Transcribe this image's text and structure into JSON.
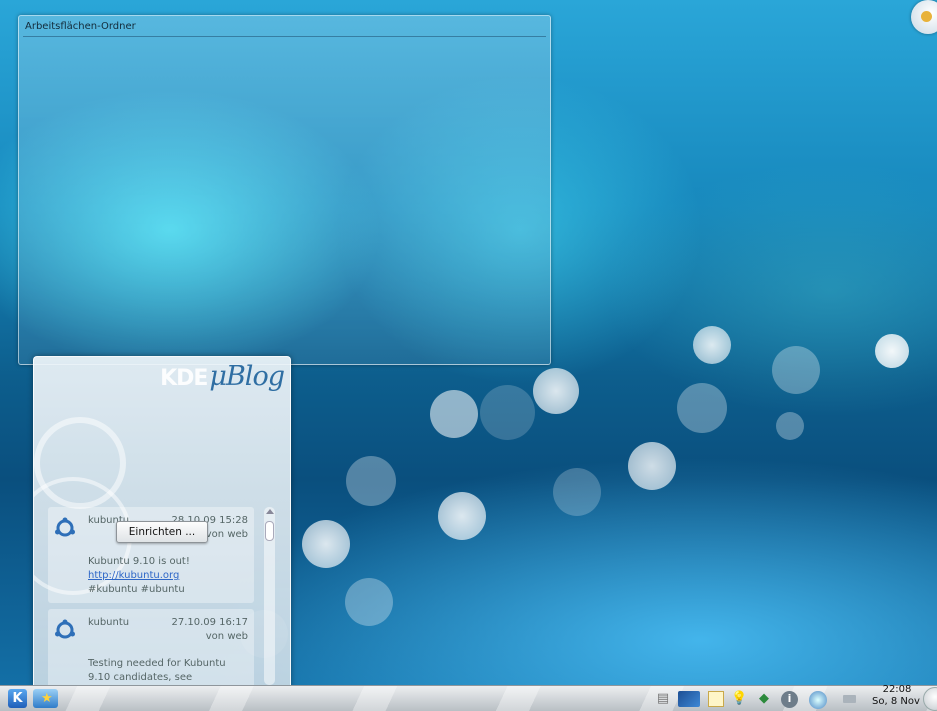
{
  "desktop": {
    "folder_view": {
      "title": "Arbeitsflächen-Ordner"
    },
    "cashew": {
      "icon": "plasma-cashew-icon"
    }
  },
  "ublog": {
    "logo_kde": "KDE",
    "logo_text": "μBlog",
    "configure_button": "Einrichten ...",
    "posts": [
      {
        "user": "kubuntu",
        "time": "28.10.09 15:28",
        "via": "von web",
        "text": "Kubuntu 9.10 is out!",
        "link": "http://kubuntu.org",
        "tags": "#kubuntu #ubuntu"
      },
      {
        "user": "kubuntu",
        "time": "27.10.09 16:17",
        "via": "von web",
        "text": "Testing needed for Kubuntu 9.10 candidates, see"
      }
    ]
  },
  "panel": {
    "kmenu_icon": "kde-menu-icon",
    "favorites_icon": "favorites-star-icon",
    "tray_icons": [
      "printer-icon",
      "display-icon",
      "clipboard-icon",
      "lightbulb-icon",
      "network-icon",
      "info-icon",
      "update-manager-icon",
      "keyboard-icon"
    ],
    "clock": {
      "time": "22:08",
      "date": "So, 8 Nov"
    }
  }
}
